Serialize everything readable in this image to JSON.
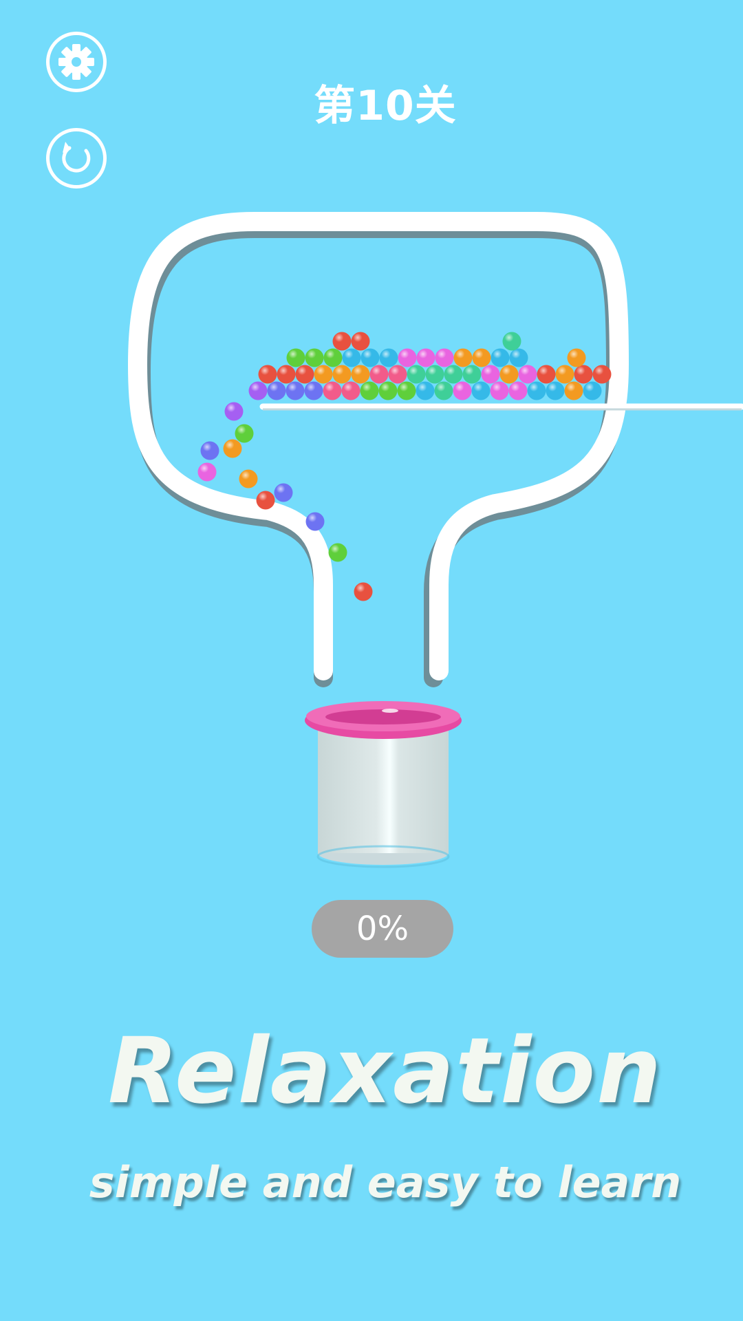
{
  "hud": {
    "level_label": "第10关",
    "settings_icon": "gear-icon",
    "restart_icon": "restart-icon"
  },
  "game": {
    "progress_text": "0%",
    "progress_value": 0,
    "colors": {
      "background": "#74dcfb",
      "pipe": "#ffffff",
      "cup_rim": "#ec4fa8",
      "cup_body": "#d3e2e2",
      "progress_pill": "#a5a5a5"
    },
    "ball_colors": [
      "#e8513f",
      "#f39a21",
      "#5fcf3b",
      "#35b9e8",
      "#6d73f2",
      "#e964e0",
      "#f25b8a",
      "#3fcf98",
      "#a55ff2"
    ]
  },
  "promo": {
    "headline": "Relaxation",
    "subline": "simple and easy to learn"
  }
}
